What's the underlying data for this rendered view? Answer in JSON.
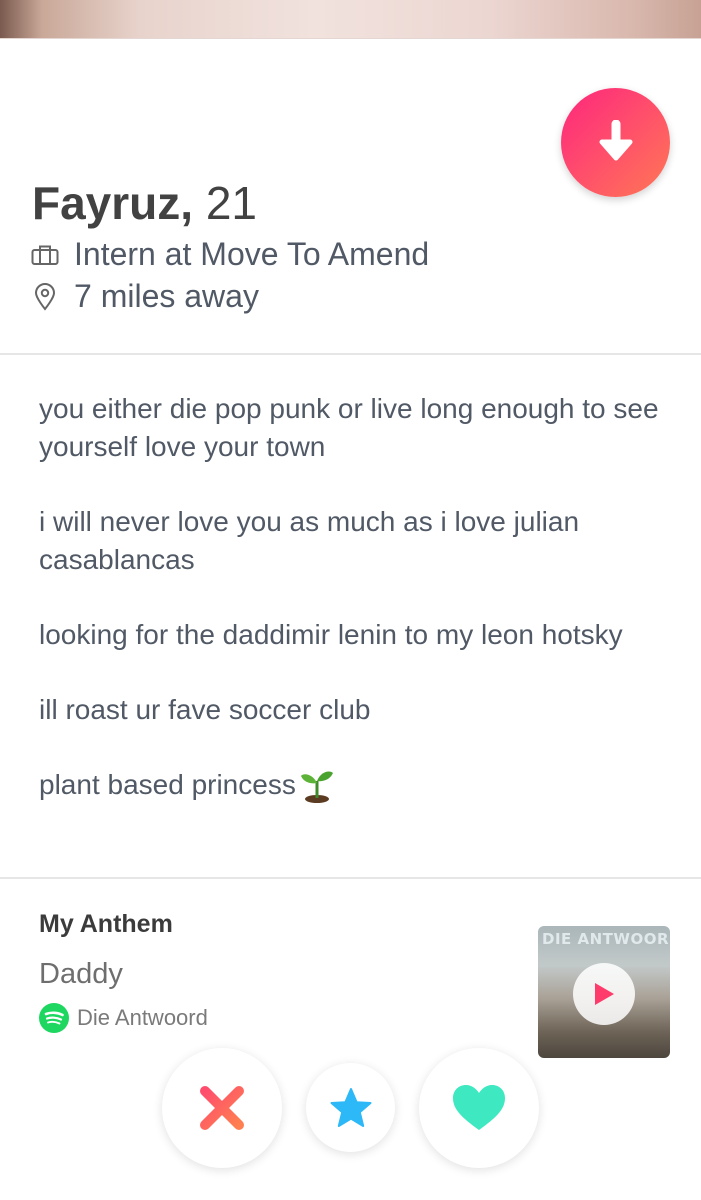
{
  "profile": {
    "name": "Fayruz,",
    "age": "21",
    "job": "Intern at Move To Amend",
    "distance": "7 miles away"
  },
  "bio": {
    "lines": [
      "you either die pop punk or live long enough to see yourself love your town",
      "i will never love you as much as i love julian casablancas",
      "looking for the daddimir lenin to my leon hotsky",
      "ill roast ur fave soccer club",
      "plant based princess"
    ]
  },
  "anthem": {
    "title": "My Anthem",
    "song": "Daddy",
    "artist": "Die Antwoord",
    "album_text": "DIE ANTWOORD"
  },
  "icons": {
    "collapse": "arrow-down-icon",
    "job": "briefcase-icon",
    "distance": "location-pin-icon",
    "emoji": "seedling-icon",
    "spotify": "spotify-icon",
    "play": "play-icon",
    "nope": "x-icon",
    "super_like": "star-icon",
    "like": "heart-icon"
  },
  "colors": {
    "brand_gradient_start": "#fd267d",
    "brand_gradient_end": "#ff7854",
    "spotify_green": "#1ed760",
    "super_like_blue": "#2db8f7",
    "like_teal": "#3ee8c0"
  }
}
